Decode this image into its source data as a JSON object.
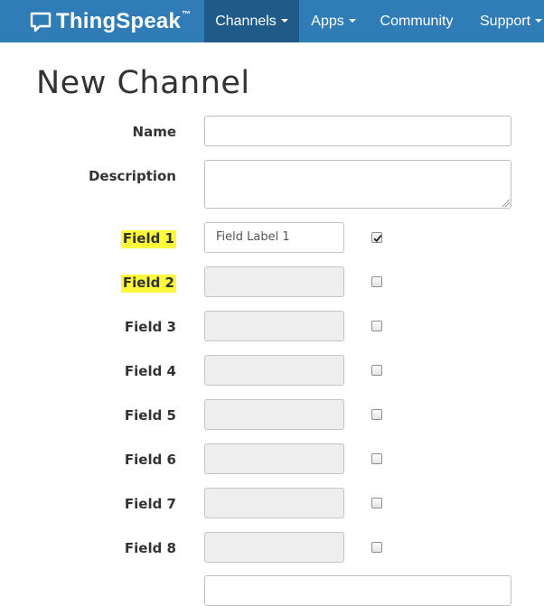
{
  "navbar": {
    "brand": "ThingSpeak",
    "brand_tm": "™",
    "items": [
      {
        "label": "Channels",
        "has_caret": true,
        "active": true
      },
      {
        "label": "Apps",
        "has_caret": true,
        "active": false
      },
      {
        "label": "Community",
        "has_caret": false,
        "active": false
      },
      {
        "label": "Support",
        "has_caret": true,
        "active": false
      }
    ]
  },
  "page": {
    "title": "New Channel"
  },
  "form": {
    "name_label": "Name",
    "name_value": "",
    "description_label": "Description",
    "description_value": "",
    "fields": [
      {
        "label": "Field 1",
        "value": "Field Label 1",
        "checked": true,
        "highlighted": true
      },
      {
        "label": "Field 2",
        "value": "",
        "checked": false,
        "highlighted": true
      },
      {
        "label": "Field 3",
        "value": "",
        "checked": false,
        "highlighted": false
      },
      {
        "label": "Field 4",
        "value": "",
        "checked": false,
        "highlighted": false
      },
      {
        "label": "Field 5",
        "value": "",
        "checked": false,
        "highlighted": false
      },
      {
        "label": "Field 6",
        "value": "",
        "checked": false,
        "highlighted": false
      },
      {
        "label": "Field 7",
        "value": "",
        "checked": false,
        "highlighted": false
      },
      {
        "label": "Field 8",
        "value": "",
        "checked": false,
        "highlighted": false
      }
    ]
  },
  "colors": {
    "navbar": "#2f7cb7",
    "navbar_active": "#1f5a88",
    "highlight": "#fbf93a"
  },
  "icons": {
    "brand": "speech-bubble-icon",
    "dropdown": "caret-down-icon",
    "checkbox_checked": "checkmark-icon",
    "textarea_resize": "resize-grip-icon"
  }
}
